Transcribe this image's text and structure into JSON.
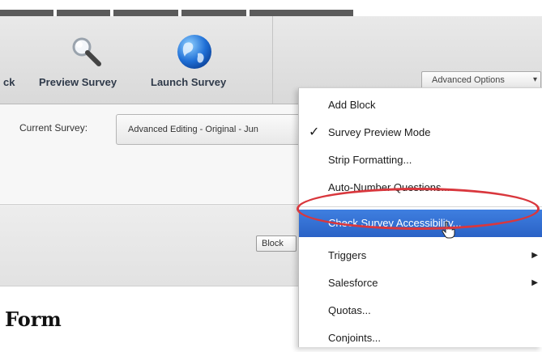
{
  "toolbar": {
    "partial_tool_label": "ck",
    "preview_label": "Preview Survey",
    "launch_label": "Launch Survey",
    "advanced_options_label": "Advanced Options",
    "advanced_options_caret": "▾"
  },
  "survey": {
    "current_label": "Current Survey:",
    "current_value": "Advanced Editing - Original - Jun"
  },
  "block_row": {
    "block_label": "Block"
  },
  "form": {
    "title": "Form"
  },
  "menu": {
    "items": [
      {
        "label": "Add Block",
        "checked": false,
        "submenu": false,
        "highlighted": false
      },
      {
        "label": "Survey Preview Mode",
        "checked": true,
        "submenu": false,
        "highlighted": false
      },
      {
        "label": "Strip Formatting...",
        "checked": false,
        "submenu": false,
        "highlighted": false
      },
      {
        "label": "Auto-Number Questions...",
        "checked": false,
        "submenu": false,
        "highlighted": false
      },
      {
        "label": "Check Survey Accessibility...",
        "checked": false,
        "submenu": false,
        "highlighted": true
      },
      {
        "label": "Triggers",
        "checked": false,
        "submenu": true,
        "highlighted": false
      },
      {
        "label": "Salesforce",
        "checked": false,
        "submenu": true,
        "highlighted": false
      },
      {
        "label": "Quotas...",
        "checked": false,
        "submenu": false,
        "highlighted": false
      },
      {
        "label": "Conjoints...",
        "checked": false,
        "submenu": false,
        "highlighted": false
      }
    ],
    "check_glyph": "✓",
    "submenu_glyph": "▶"
  },
  "colors": {
    "highlight": "#2f6bd0",
    "annotation_ring": "#d9373d"
  },
  "icons": {
    "preview": "magnifier-icon",
    "launch": "globe-icon",
    "cursor": "hand-cursor-icon"
  }
}
